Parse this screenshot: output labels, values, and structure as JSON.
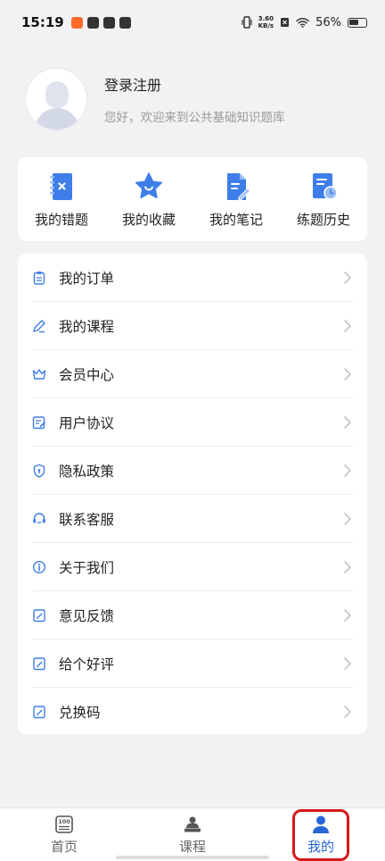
{
  "status_bar": {
    "time": "15:19",
    "network_speed_top": "3.60",
    "network_speed_bottom": "KB/s",
    "battery": "56%"
  },
  "profile": {
    "login": "登录注册",
    "welcome": "您好，欢迎来到公共基础知识题库"
  },
  "quick_actions": [
    {
      "label": "我的错题",
      "icon": "wrong-questions-book-icon"
    },
    {
      "label": "我的收藏",
      "icon": "star-icon"
    },
    {
      "label": "我的笔记",
      "icon": "note-pen-icon"
    },
    {
      "label": "练题历史",
      "icon": "history-clock-icon"
    }
  ],
  "menu": [
    {
      "label": "我的订单",
      "icon": "order-clipboard-icon"
    },
    {
      "label": "我的课程",
      "icon": "course-pencil-icon"
    },
    {
      "label": "会员中心",
      "icon": "crown-icon"
    },
    {
      "label": "用户协议",
      "icon": "agreement-doc-icon"
    },
    {
      "label": "隐私政策",
      "icon": "shield-icon"
    },
    {
      "label": "联系客服",
      "icon": "headset-icon"
    },
    {
      "label": "关于我们",
      "icon": "info-icon"
    },
    {
      "label": "意见反馈",
      "icon": "feedback-edit-icon"
    },
    {
      "label": "给个好评",
      "icon": "rate-edit-icon"
    },
    {
      "label": "兑换码",
      "icon": "redeem-edit-icon"
    }
  ],
  "tabs": [
    {
      "label": "首页",
      "icon": "home-100-icon"
    },
    {
      "label": "课程",
      "icon": "course-teacher-icon"
    },
    {
      "label": "我的",
      "icon": "user-icon"
    }
  ],
  "colors": {
    "accent": "#2766d6",
    "highlight": "#d81818"
  }
}
